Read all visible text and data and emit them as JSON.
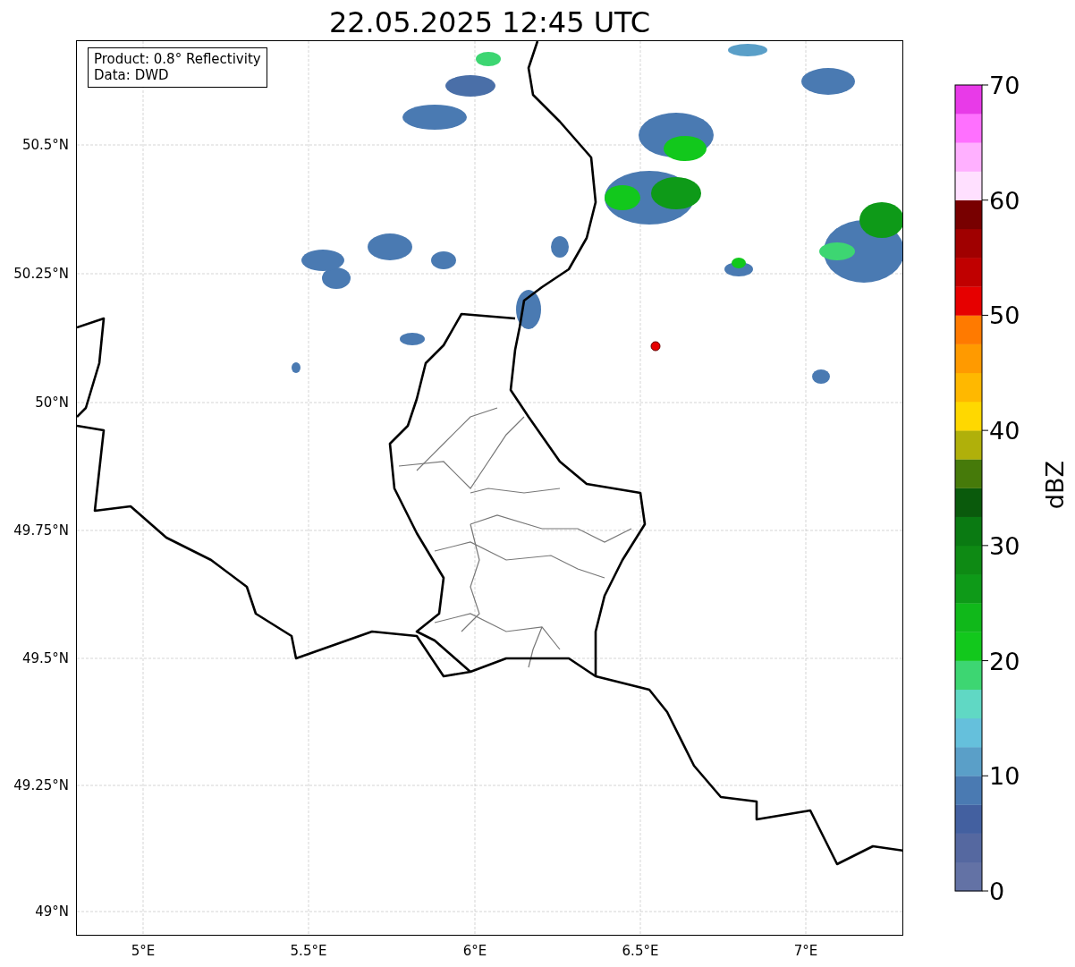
{
  "title": "22.05.2025 12:45 UTC",
  "info_box": [
    "Product: 0.8° Reflectivity",
    "Data: DWD"
  ],
  "map": {
    "y_tick_labels": [
      "50.5°N",
      "50.25°N",
      "50°N",
      "49.75°N",
      "49.5°N",
      "49.25°N",
      "49°N"
    ],
    "x_tick_labels": [
      "5°E",
      "5.5°E",
      "6°E",
      "6.5°E",
      "7°E"
    ]
  },
  "colorbar": {
    "label": "dBZ",
    "tick_labels": [
      "70",
      "60",
      "50",
      "40",
      "30",
      "20",
      "10",
      "0"
    ],
    "segments": [
      {
        "color": "#6372a5"
      },
      {
        "color": "#5568a0"
      },
      {
        "color": "#4360a0"
      },
      {
        "color": "#4a7ab2"
      },
      {
        "color": "#5a9fc8"
      },
      {
        "color": "#65c0dc"
      },
      {
        "color": "#60d8c4"
      },
      {
        "color": "#3dd672"
      },
      {
        "color": "#12c81c"
      },
      {
        "color": "#10b81a"
      },
      {
        "color": "#0e9a18"
      },
      {
        "color": "#0e8a14"
      },
      {
        "color": "#0a7a12"
      },
      {
        "color": "#0a5a0c"
      },
      {
        "color": "#467a0a"
      },
      {
        "color": "#b0b00a"
      },
      {
        "color": "#ffd800"
      },
      {
        "color": "#ffb800"
      },
      {
        "color": "#ff9a00"
      },
      {
        "color": "#ff7a00"
      },
      {
        "color": "#e60000"
      },
      {
        "color": "#c00000"
      },
      {
        "color": "#a00000"
      },
      {
        "color": "#780000"
      },
      {
        "color": "#ffe0ff"
      },
      {
        "color": "#ffb0ff"
      },
      {
        "color": "#ff70ff"
      },
      {
        "color": "#e83ae8"
      }
    ]
  }
}
